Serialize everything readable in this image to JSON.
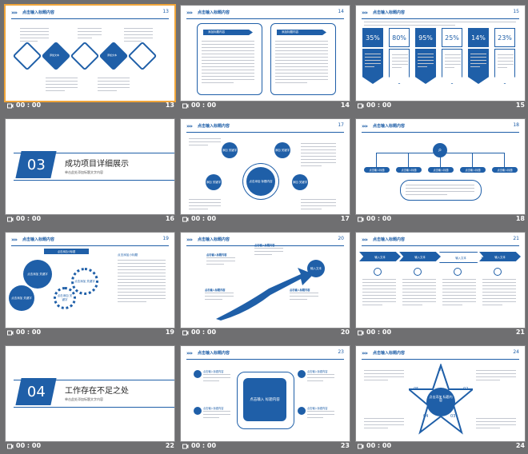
{
  "header_title": "点击输入标题内容",
  "placeholder_text": "添加标题内容",
  "timer_label": "00 : 00",
  "slides": [
    {
      "number": "13",
      "type": "diamonds",
      "header_num": "13"
    },
    {
      "number": "14",
      "type": "two-boxes",
      "header_num": "14",
      "box_label": "添加标题内容"
    },
    {
      "number": "15",
      "type": "percent-cards",
      "header_num": "15",
      "percents": [
        "35%",
        "80%",
        "95%",
        "25%",
        "14%",
        "23%"
      ]
    },
    {
      "number": "16",
      "type": "section",
      "section_num": "03",
      "title": "成功项目详细展示",
      "subtitle": "单击此处添加标题文字内容"
    },
    {
      "number": "17",
      "type": "circles",
      "header_num": "17",
      "center_label": "点击添加\n标题内容",
      "node_label": "添加\n关键字"
    },
    {
      "number": "18",
      "type": "tree",
      "header_num": "18",
      "pill_label": "点击输入标题"
    },
    {
      "number": "19",
      "type": "gears",
      "header_num": "19",
      "tag_label": "点击添加小标题",
      "gear_label": "点击添加\n关键字",
      "side_title": "点击添加小标题"
    },
    {
      "number": "20",
      "type": "growth-arrow",
      "header_num": "20",
      "end_label": "输入文本",
      "node_title": "点击输入标题内容"
    },
    {
      "number": "21",
      "type": "chevrons",
      "header_num": "21",
      "chevron_label": "输入文本"
    },
    {
      "number": "22",
      "type": "section",
      "section_num": "04",
      "title": "工作存在不足之处",
      "subtitle": "单击此处添加标题文字内容"
    },
    {
      "number": "23",
      "type": "center-box",
      "header_num": "23",
      "center_label": "点击输入\n标题内容",
      "item_title": "点击输入标题内容"
    },
    {
      "number": "24",
      "type": "star",
      "header_num": "24",
      "center_label": "点击添加\n标题内容",
      "star_nums": [
        "01",
        "02",
        "03",
        "04",
        "05"
      ]
    }
  ],
  "selected_slide": "13"
}
